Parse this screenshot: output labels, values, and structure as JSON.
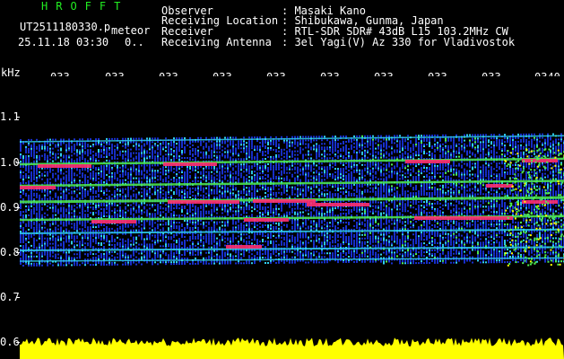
{
  "header": {
    "logo": "HROFFT",
    "filename": "UT2511180330.pn",
    "mode": "meteor",
    "datetime": "25.11.18 03:30",
    "counter": "0..",
    "fields": [
      {
        "label": "Observer",
        "value": ": Masaki Kano"
      },
      {
        "label": "Receiving Location",
        "value": ": Shibukawa, Gunma, Japan"
      },
      {
        "label": "Receiver",
        "value": ": RTL-SDR SDR# 43dB L15 103.2MHz CW"
      },
      {
        "label": "Receiving Antenna",
        "value": ": 3el Yagi(V) Az 330 for Vladivostok"
      }
    ]
  },
  "axis": {
    "unit": "kHz",
    "y_ticks": [
      "1.1",
      "1.0",
      "0.9",
      "0.8",
      "0.7",
      "0.6"
    ],
    "x_ticks": [
      "033",
      "033",
      "033",
      "033",
      "033",
      "033",
      "033",
      "033",
      "033",
      "0340"
    ]
  },
  "colors": {
    "background": "#000000",
    "noise_blue": "#1830d0",
    "echo_cyan": "#30d0f0",
    "echo_green": "#50f050",
    "echo_red": "#ff3070",
    "level_yellow": "#ffff00"
  }
}
